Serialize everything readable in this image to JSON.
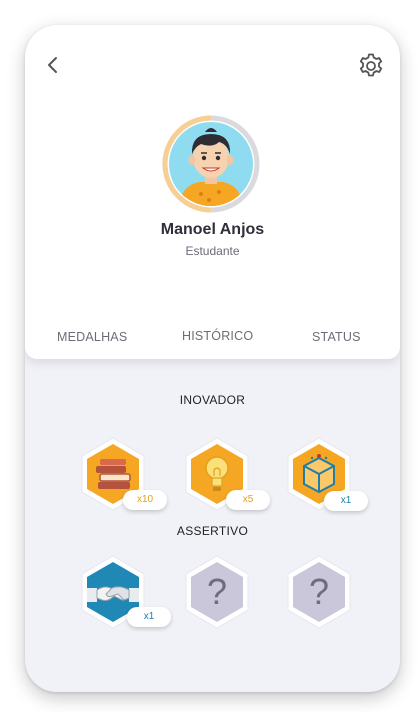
{
  "profile": {
    "name": "Manoel Anjos",
    "role": "Estudante"
  },
  "tabs": [
    "MEDALHAS",
    "HISTÓRICO",
    "STATUS"
  ],
  "sections": [
    {
      "title": "INOVADOR",
      "medals": [
        {
          "icon": "books-icon",
          "count": "x10",
          "locked": false
        },
        {
          "icon": "lightbulb-icon",
          "count": "x5",
          "locked": false
        },
        {
          "icon": "cube-icon",
          "count": "x1",
          "locked": false
        }
      ]
    },
    {
      "title": "ASSERTIVO",
      "medals": [
        {
          "icon": "handshake-icon",
          "count": "x1",
          "locked": false
        },
        {
          "icon": "question-icon",
          "count": "",
          "locked": true
        },
        {
          "icon": "question-icon",
          "count": "",
          "locked": true
        }
      ]
    }
  ],
  "colors": {
    "accent_orange": "#f5a623",
    "accent_blue": "#1f88b5",
    "locked_gray": "#c9c7d9"
  }
}
